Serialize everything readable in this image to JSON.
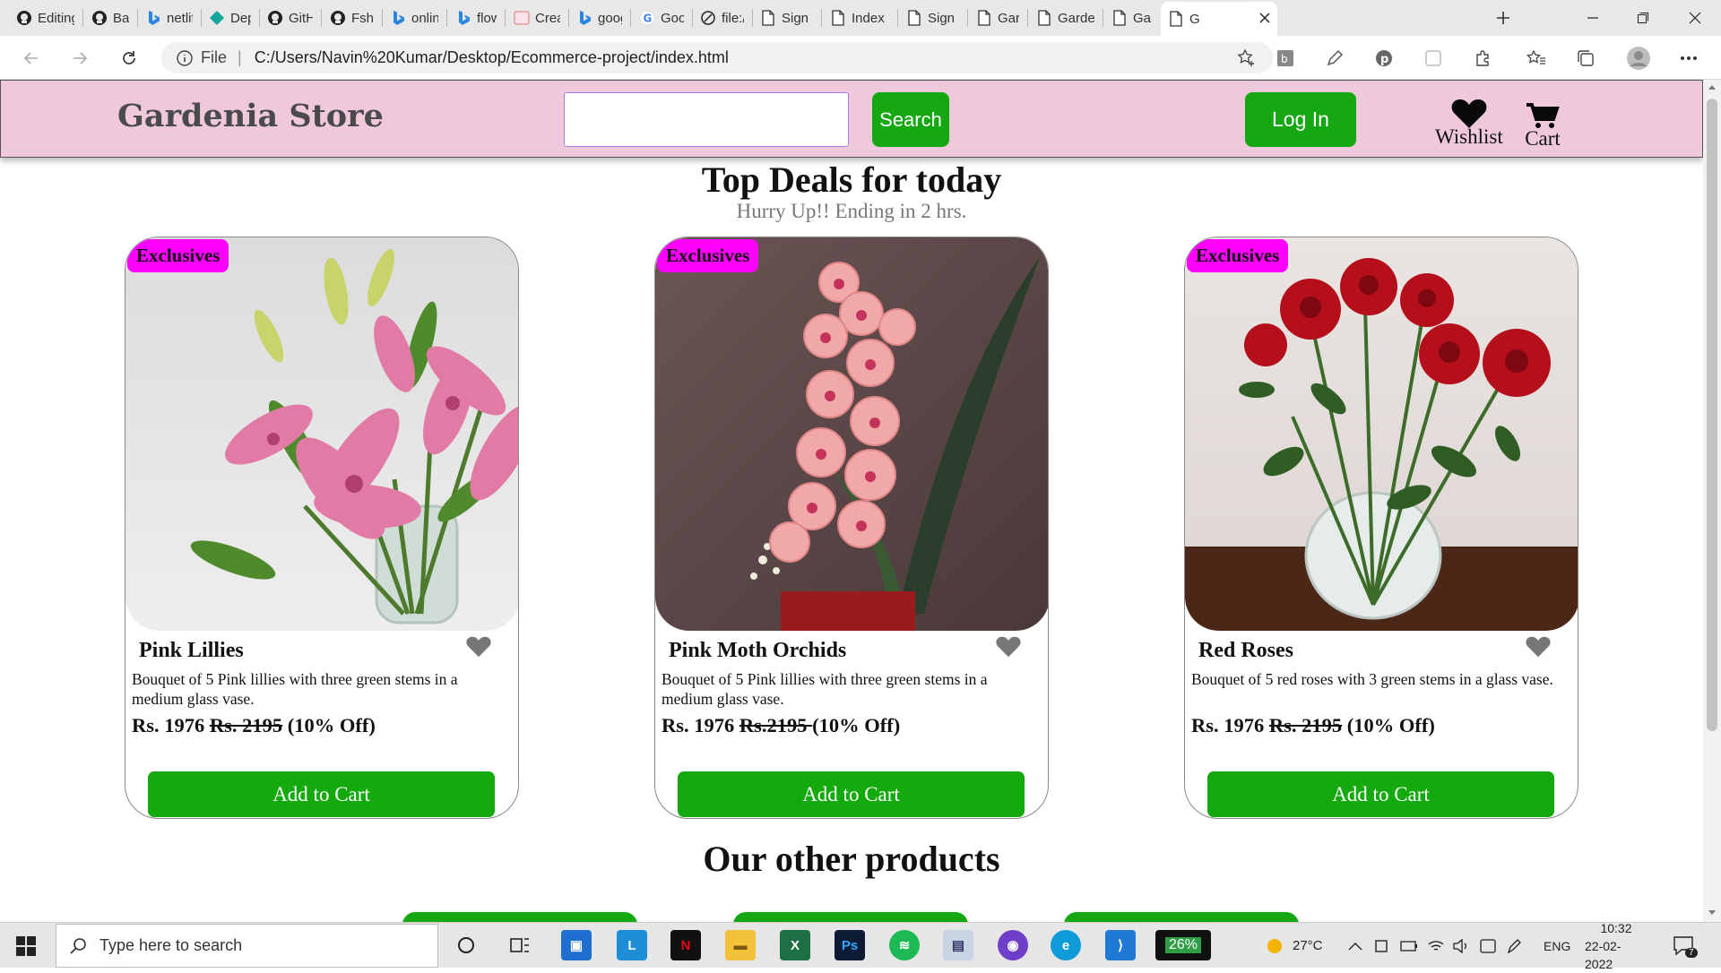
{
  "browser": {
    "tabs": [
      {
        "label": "Editing",
        "icon": "github-icon"
      },
      {
        "label": "Basic",
        "icon": "github-icon"
      },
      {
        "label": "netlify",
        "icon": "bing-icon"
      },
      {
        "label": "Deplo",
        "icon": "netlify-icon"
      },
      {
        "label": "GitHu",
        "icon": "github-icon"
      },
      {
        "label": "Fsharp",
        "icon": "github-icon"
      },
      {
        "label": "online",
        "icon": "bing-icon"
      },
      {
        "label": "flower",
        "icon": "bing-icon"
      },
      {
        "label": "Creati",
        "icon": "creative-icon"
      },
      {
        "label": "googl",
        "icon": "bing-icon"
      },
      {
        "label": "Googl",
        "icon": "google-icon"
      },
      {
        "label": "file:///",
        "icon": "file-icon"
      },
      {
        "label": "Sign u",
        "icon": "page-icon"
      },
      {
        "label": "Index",
        "icon": "page-icon"
      },
      {
        "label": "Sign u",
        "icon": "page-icon"
      },
      {
        "label": "Garde",
        "icon": "page-icon"
      },
      {
        "label": "Garde",
        "icon": "page-icon"
      },
      {
        "label": "Garde",
        "icon": "page-icon"
      },
      {
        "label": "G",
        "icon": "page-icon",
        "active": true
      }
    ],
    "address_prefix": "File",
    "url": "C:/Users/Navin%20Kumar/Desktop/Ecommerce-project/index.html"
  },
  "store": {
    "brand": "Gardenia Store",
    "search_value": "",
    "search_button": "Search",
    "login_button": "Log In",
    "wishlist_label": "Wishlist",
    "cart_label": "Cart"
  },
  "deals": {
    "title": "Top Deals for today",
    "subtitle": "Hurry Up!! Ending in 2 hrs.",
    "products": [
      {
        "badge": "Exclusives",
        "name": "Pink Lillies",
        "description": "Bouquet of 5 Pink lillies with three green stems in a medium glass vase.",
        "price": "Rs. 1976",
        "old_price": "Rs. 2195",
        "discount": "(10% Off)",
        "button": "Add to Cart"
      },
      {
        "badge": "Exclusives",
        "name": "Pink Moth Orchids",
        "description": "Bouquet of 5 Pink lillies with three green stems in a medium glass vase.",
        "price": "Rs. 1976",
        "old_price": "Rs.2195 ",
        "discount": "(10% Off)",
        "button": "Add to Cart"
      },
      {
        "badge": "Exclusives",
        "name": "Red Roses",
        "description": "Bouquet of 5 red roses with 3 green stems in a glass vase.",
        "price": "Rs. 1976",
        "old_price": "Rs. 2195",
        "discount": "(10% Off)",
        "button": "Add to Cart"
      }
    ]
  },
  "other": {
    "title": "Our other products"
  },
  "taskbar": {
    "search_placeholder": "Type here to search",
    "battery_widget": "26%",
    "weather": "27°C",
    "language": "ENG",
    "time": "10:32",
    "date": "22-02-2022",
    "notifications": "7"
  },
  "colors": {
    "nav_bg": "#efc8dc",
    "accent_green": "#16a812",
    "badge_magenta": "#ff00ff"
  }
}
